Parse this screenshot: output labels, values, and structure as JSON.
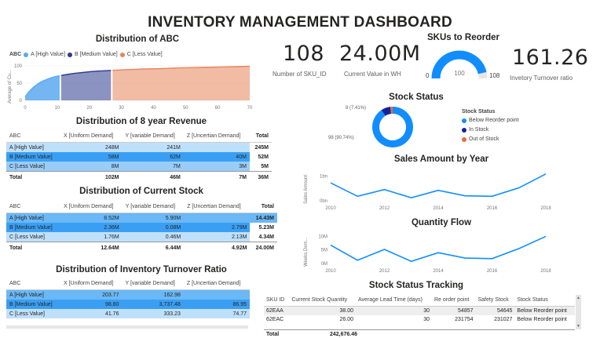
{
  "dashboard": {
    "title": "INVENTORY MANAGEMENT DASHBOARD"
  },
  "colors": {
    "a": "#5aa9f0",
    "b": "#2b3a8c",
    "c": "#e8835a",
    "accent": "#118dff"
  },
  "abc_chart": {
    "title": "Distribution of ABC",
    "legend_label": "ABC",
    "legend": [
      "A [High Value]",
      "B [Medium Value]",
      "C [Less Value]"
    ],
    "ylabel": "Average of Cu...",
    "yticks": [
      "100",
      "50",
      "0"
    ],
    "xticks": [
      "0",
      "10",
      "20",
      "30",
      "40",
      "50",
      "60",
      "70"
    ]
  },
  "chart_data": [
    {
      "type": "area",
      "title": "Distribution of ABC",
      "ylabel": "Average of Cu...",
      "xlim": [
        0,
        70
      ],
      "ylim": [
        0,
        100
      ],
      "series": [
        {
          "name": "A [High Value]",
          "x": [
            0,
            1,
            2,
            3,
            4,
            5,
            6,
            7,
            8,
            9,
            10,
            11
          ],
          "values": [
            10,
            23,
            33,
            41,
            48,
            54,
            58,
            62,
            65,
            68,
            70,
            72
          ]
        },
        {
          "name": "B [Medium Value]",
          "x": [
            11,
            13,
            15,
            17,
            19,
            21,
            23,
            25,
            27
          ],
          "values": [
            72,
            75,
            78,
            80,
            82,
            84,
            85,
            86,
            87
          ]
        },
        {
          "name": "C [Less Value]",
          "x": [
            27,
            32,
            37,
            42,
            47,
            52,
            57,
            62,
            67,
            70
          ],
          "values": [
            87,
            89,
            91,
            92,
            94,
            95,
            96,
            97,
            98,
            99
          ]
        }
      ]
    },
    {
      "type": "line",
      "title": "Sales Amount by Year",
      "ylabel": "Sales Amount",
      "yticks": [
        "1bn",
        "0bn"
      ],
      "xticks": [
        "2010",
        "2012",
        "2014",
        "2016",
        "2018"
      ],
      "x": [
        2010,
        2011,
        2012,
        2013,
        2014,
        2015,
        2016,
        2017,
        2018
      ],
      "values": [
        0.72,
        0.18,
        0.45,
        0.12,
        0.42,
        0.2,
        0.18,
        0.52,
        1.08
      ],
      "ylim": [
        0,
        1.2
      ]
    },
    {
      "type": "line",
      "title": "Quantity Flow",
      "ylabel": "Weeks Dem...",
      "yticks": [
        "10M",
        "5M",
        "0M"
      ],
      "xticks": [
        "2010",
        "2012",
        "2014",
        "2016",
        "2018"
      ],
      "x": [
        2010,
        2011,
        2012,
        2013,
        2014,
        2015,
        2016,
        2017,
        2018
      ],
      "values": [
        6.8,
        1.2,
        5.2,
        0.8,
        4.0,
        2.0,
        1.8,
        5.5,
        10.0
      ],
      "ylim": [
        0,
        11
      ]
    },
    {
      "type": "pie",
      "title": "Stock Status",
      "legend_title": "Stock Status",
      "categories": [
        "Below Reorder point",
        "In Stock",
        "Out of Stock"
      ],
      "values": [
        98,
        8,
        2
      ],
      "labels": [
        "98 (90.74%)",
        "8 (7.41%)"
      ]
    }
  ],
  "kpis": {
    "sku_count": {
      "value": "108",
      "label": "Number of SKU_ID"
    },
    "current_value": {
      "value": "24.00M",
      "label": "Current Value in WH"
    },
    "turnover": {
      "value": "161.26",
      "label": "Invetory Turnover ratio"
    }
  },
  "reorder_gauge": {
    "title": "SKUs to Reorder",
    "min": "0",
    "max": "108",
    "value": "100",
    "value_num": 100,
    "max_num": 108
  },
  "stock_status": {
    "title": "Stock Status",
    "legend_title": "Stock Status",
    "legend": [
      "Below Reorder point",
      "In Stock",
      "Out of Stock"
    ],
    "label_big": "98 (90.74%)",
    "label_small": "8 (7.41%)",
    "colors": [
      "#118dff",
      "#12239e",
      "#e66c37"
    ]
  },
  "sales_chart": {
    "title": "Sales Amount by Year"
  },
  "qty_chart": {
    "title": "Quantity Flow"
  },
  "revenue_table": {
    "title": "Distribution of 8 year Revenue",
    "headers": [
      "ABC",
      "X [Uniform Demand]",
      "Y [variable Demand]",
      "Z [Uncertian Demand]",
      "Total"
    ],
    "rows": [
      [
        "A [High Value]",
        "248M",
        "241M",
        "",
        "245M"
      ],
      [
        "B [Medium Value]",
        "58M",
        "62M",
        "40M",
        "52M"
      ],
      [
        "C [Less Value]",
        "8M",
        "7M",
        "3M",
        "5M"
      ]
    ],
    "total": [
      "Total",
      "102M",
      "46M",
      "7M",
      "36M"
    ]
  },
  "stock_table": {
    "title": "Distribution of Current Stock",
    "headers": [
      "ABC",
      "X [Uniform Demand]",
      "Y [variable Demand]",
      "Z [Uncertian Demand]",
      "Total"
    ],
    "rows": [
      [
        "A [High Value]",
        "8.52M",
        "5.90M",
        "",
        "14.43M"
      ],
      [
        "B [Medium Value]",
        "2.36M",
        "0.08M",
        "2.79M",
        "5.23M"
      ],
      [
        "C [Less Value]",
        "1.76M",
        "0.46M",
        "2.13M",
        "4.34M"
      ]
    ],
    "total": [
      "Total",
      "12.64M",
      "6.44M",
      "4.92M",
      "24.00M"
    ]
  },
  "turnover_table": {
    "title": "Distribution of Inventory Turnover Ratio",
    "headers": [
      "ABC",
      "X [Uniform Demand]",
      "Y [variable Demand]",
      "Z [Uncertian Demand]"
    ],
    "rows": [
      [
        "A [High Value]",
        "203.77",
        "162.98",
        ""
      ],
      [
        "B [Medium Value]",
        "98.80",
        "3,737.48",
        "86.95"
      ],
      [
        "C [Less Value]",
        "41.76",
        "333.23",
        "74.77"
      ]
    ]
  },
  "tracking": {
    "title": "Stock Status Tracking",
    "headers": [
      "SKU ID",
      "Current Stock Quantity",
      "Average Lead Time (days)",
      "Re order point",
      "Safety Stock",
      "Stock Status"
    ],
    "rows": [
      [
        "62EAA",
        "38.00",
        "30",
        "54857",
        "54645",
        "Below Reorder point"
      ],
      [
        "62EAC",
        "26.00",
        "30",
        "231754",
        "231027",
        "Below Reorder point"
      ]
    ],
    "total": [
      "Total",
      "242,676.46",
      "",
      "",
      "",
      ""
    ]
  }
}
